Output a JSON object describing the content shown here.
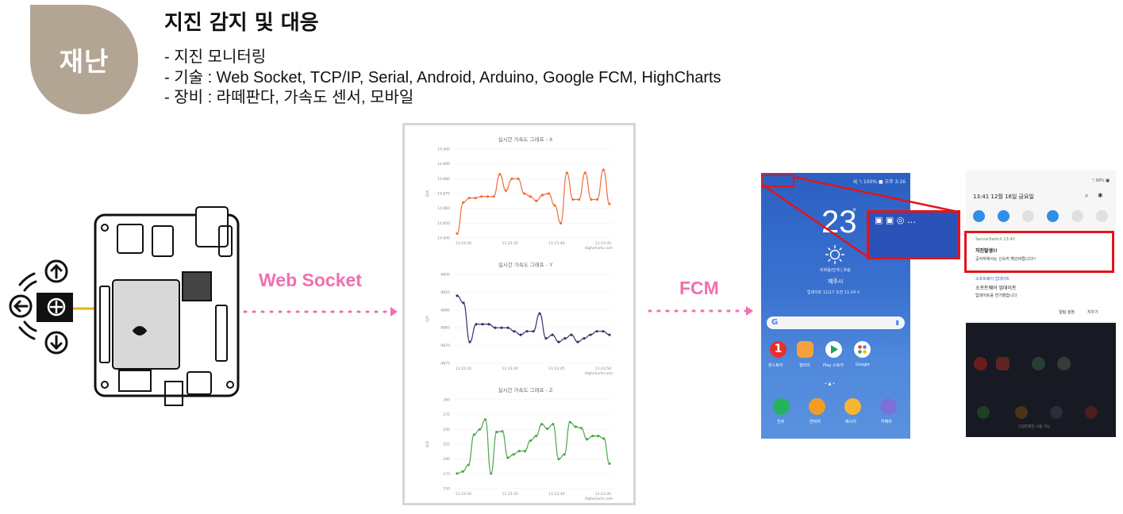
{
  "header": {
    "badge": "재난",
    "title": "지진 감지 및 대응",
    "lines": [
      "- 지진 모니터링",
      "- 기술 : Web Socket, TCP/IP, Serial, Android,  Arduino, Google FCM, HighCharts",
      "- 장비 : 라떼판다, 가속도 센서, 모바일"
    ]
  },
  "flow": {
    "label1": "Web Socket",
    "label2": "FCM",
    "arrow_color": "#f26fae"
  },
  "colors": {
    "badge": "#b3a594",
    "series_x": "#f0703c",
    "series_y": "#3a3270",
    "series_z": "#4fa64f",
    "highlight": "#e3141b"
  },
  "chart_data": [
    {
      "type": "line",
      "title": "실시간 가속도 그래프 - X",
      "ylabel": "G/X",
      "yticks": [
        "14.900",
        "14.890",
        "14.880",
        "14.870",
        "14.860",
        "14.850",
        "14.840"
      ],
      "xticks": [
        "11:23:30",
        "11:23:35",
        "11:23:40",
        "11:23:45"
      ],
      "credits": "Highcharts.com",
      "ylim": [
        14.84,
        14.9
      ],
      "values": [
        14.843,
        14.864,
        14.867,
        14.867,
        14.868,
        14.868,
        14.868,
        14.883,
        14.872,
        14.88,
        14.88,
        14.87,
        14.868,
        14.865,
        14.869,
        14.87,
        14.862,
        14.85,
        14.884,
        14.866,
        14.866,
        14.884,
        14.866,
        14.866,
        14.886,
        14.863
      ]
    },
    {
      "type": "line",
      "title": "실시간 가속도 그래프 - Y",
      "ylabel": "G/Y",
      "yticks": [
        "-9850",
        "-9855",
        "-9860",
        "-9865",
        "-9870",
        "-9875"
      ],
      "xticks": [
        "11:23:35",
        "11:23:40",
        "11:23:45",
        "11:23:50"
      ],
      "credits": "Highcharts.com",
      "ylim": [
        -9875,
        -9850
      ],
      "values": [
        -9856,
        -9858,
        -9869,
        -9864,
        -9864,
        -9864,
        -9865,
        -9865,
        -9865,
        -9866,
        -9867,
        -9866,
        -9866,
        -9861,
        -9868,
        -9867,
        -9869,
        -9868,
        -9867,
        -9869,
        -9868,
        -9867,
        -9866,
        -9866,
        -9867
      ]
    },
    {
      "type": "line",
      "title": "실시간 가속도 그래프 - Z",
      "ylabel": "G/Z",
      "yticks": [
        "260",
        "275",
        "250",
        "225",
        "200",
        "175",
        "150"
      ],
      "xticks": [
        "11:23:30",
        "11:23:35",
        "11:23:40",
        "11:23:45"
      ],
      "credits": "Highcharts.com",
      "ylim": [
        150,
        285
      ],
      "values": [
        173,
        176,
        186,
        232,
        240,
        255,
        173,
        236,
        237,
        197,
        202,
        207,
        207,
        223,
        230,
        248,
        241,
        248,
        195,
        202,
        251,
        244,
        242,
        225,
        230,
        230,
        226,
        188
      ]
    }
  ],
  "phone1": {
    "status": "4|  ⁴ⱼ  100% ■ 오후 3:16",
    "temp": "23",
    "location_small": "비바람/안개 | 흐림",
    "city": "제주시",
    "updated": "업데이트 11/17 오전 11:14 ↻",
    "search_hint": "G",
    "apps_row1": [
      "원스토어",
      "갤러리",
      "Play 스토어",
      "Google"
    ],
    "apps_row2": [
      "전화",
      "연락처",
      "메시지",
      "카메라"
    ],
    "zoom_icons": "▣ ▣ ◎ …"
  },
  "phone2": {
    "status": "⁴ⱼ 99% ■",
    "time_date": "13:41  12월 18일 금요일",
    "notif1_app": "SensorSwitch  13:40",
    "notif1_title": "지진발생!!",
    "notif1_body": "공지자에서는 신속히 확인바랍니다!!",
    "notif2_app": "소프트웨어 업데이트",
    "notif2_title": "소프트웨어 업데이트",
    "notif2_body": "업데이트를 연기했습니다",
    "action1": "알림 설정",
    "action2": "지우기",
    "bottom_text": "긴급전화만 사용 가능"
  }
}
